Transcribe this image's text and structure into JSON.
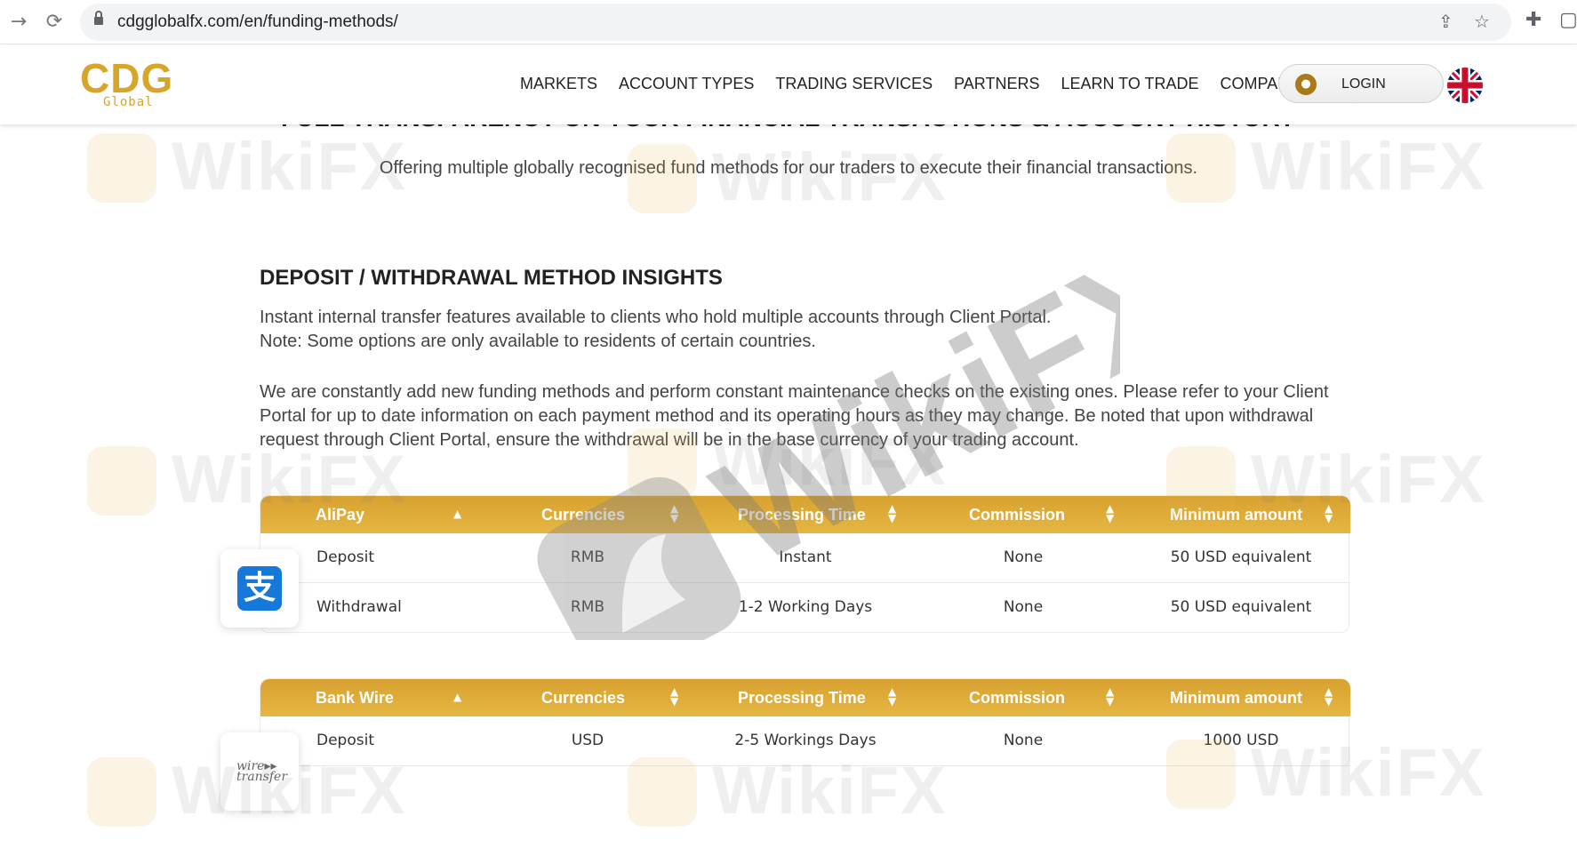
{
  "browser": {
    "url": "cdgglobalfx.com/en/funding-methods/",
    "back_icon": "arrow-right-icon",
    "reload_icon": "reload-icon",
    "share_icon": "share-icon",
    "star_icon": "star-icon",
    "extensions_icon": "puzzle-icon",
    "window_icon": "window-icon"
  },
  "site": {
    "logo_main": "CDG",
    "logo_sub": "Global",
    "nav": [
      "MARKETS",
      "ACCOUNT TYPES",
      "TRADING SERVICES",
      "PARTNERS",
      "LEARN TO TRADE",
      "COMPANY"
    ],
    "login_label": "LOGIN",
    "language_flag": "uk-flag-icon"
  },
  "content": {
    "cut_heading": "FULL TRANSPARENCY ON YOUR FINANCIAL TRANSACTIONS & ACCOUNT HISTORY",
    "subtitle": "Offering multiple globally recognised fund methods for our traders to execute their financial transactions.",
    "section_title": "DEPOSIT / WITHDRAWAL METHOD INSIGHTS",
    "paragraph1": "Instant internal transfer features available to clients who hold multiple accounts through Client Portal.",
    "paragraph2": "Note: Some options are only available to residents of certain countries.",
    "paragraph3": "We are constantly add new funding methods and perform constant maintenance checks on the existing ones. Please refer to your Client Portal for up to date information on each payment method and its operating hours as they may change. Be noted that upon withdrawal request through Client Portal, ensure the withdrawal will be in the base currency of your trading account."
  },
  "tables": [
    {
      "method": "AliPay",
      "icon": "alipay-icon",
      "headers": [
        "AliPay",
        "Currencies",
        "Processing Time",
        "Commission",
        "Minimum amount"
      ],
      "rows": [
        [
          "Deposit",
          "RMB",
          "Instant",
          "None",
          "50 USD equivalent"
        ],
        [
          "Withdrawal",
          "RMB",
          "1-2 Working Days",
          "None",
          "50 USD equivalent"
        ]
      ]
    },
    {
      "method": "Bank Wire",
      "icon": "wire-transfer-icon",
      "icon_text": [
        "wire",
        "transfer"
      ],
      "headers": [
        "Bank Wire",
        "Currencies",
        "Processing Time",
        "Commission",
        "Minimum amount"
      ],
      "rows": [
        [
          "Deposit",
          "USD",
          "2-5 Workings Days",
          "None",
          "1000 USD"
        ]
      ]
    }
  ],
  "watermark": {
    "text": "WikiFX"
  }
}
